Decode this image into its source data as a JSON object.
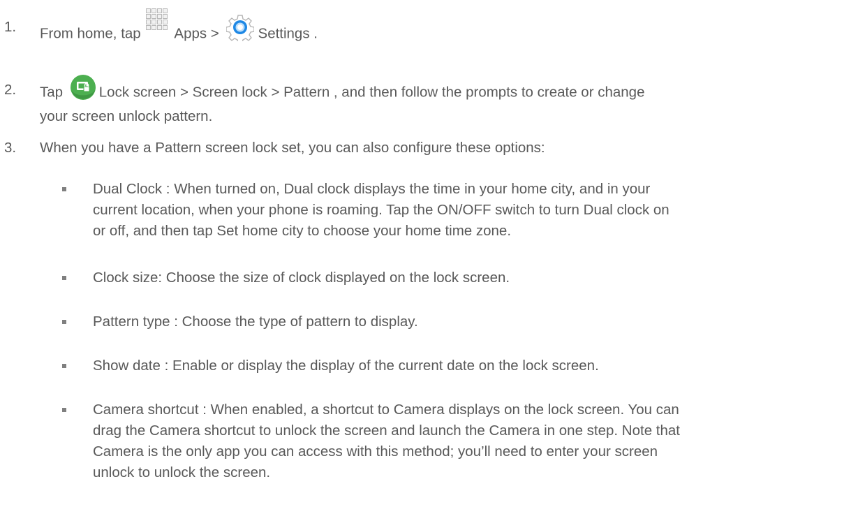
{
  "steps": [
    {
      "number": "1.",
      "part1": "From home, tap",
      "apps_icon": "apps-grid-icon",
      "part2": "Apps  >",
      "settings_icon": "settings-gear-icon",
      "part3": "Settings ."
    },
    {
      "number": "2.",
      "part1": "Tap",
      "lock_icon": "lock-screen-icon",
      "line1_rest": "Lock screen  > Screen lock  > Pattern , and then follow the prompts to create or change",
      "line2": "your screen unlock pattern."
    },
    {
      "number": "3.",
      "text": "When you have a Pattern screen lock set, you can also configure these options:"
    }
  ],
  "bullets": [
    {
      "lines": [
        "Dual Clock : When turned on, Dual clock displays the time in your home city, and in your",
        "current location, when your phone is roaming. Tap the ON/OFF switch to turn Dual clock on",
        "or off, and then tap Set home city  to choose your home time zone."
      ]
    },
    {
      "lines": [
        "Clock size:  Choose the size of clock displayed on the lock screen."
      ]
    },
    {
      "lines": [
        "Pattern type : Choose the type of pattern to display."
      ]
    },
    {
      "lines": [
        "Show date : Enable or display the display of the current date on the lock screen."
      ]
    },
    {
      "lines": [
        "Camera shortcut  : When enabled, a shortcut to Camera displays on the lock screen. You can",
        "drag the Camera shortcut to unlock the screen and launch the Camera in one step. Note that",
        "Camera is the only app you can access with this method; you’ll need to enter your screen",
        "unlock to unlock the screen."
      ]
    }
  ],
  "colors": {
    "text": "#595959",
    "bullet": "#808080",
    "lock_icon_green": "#4caf50"
  }
}
